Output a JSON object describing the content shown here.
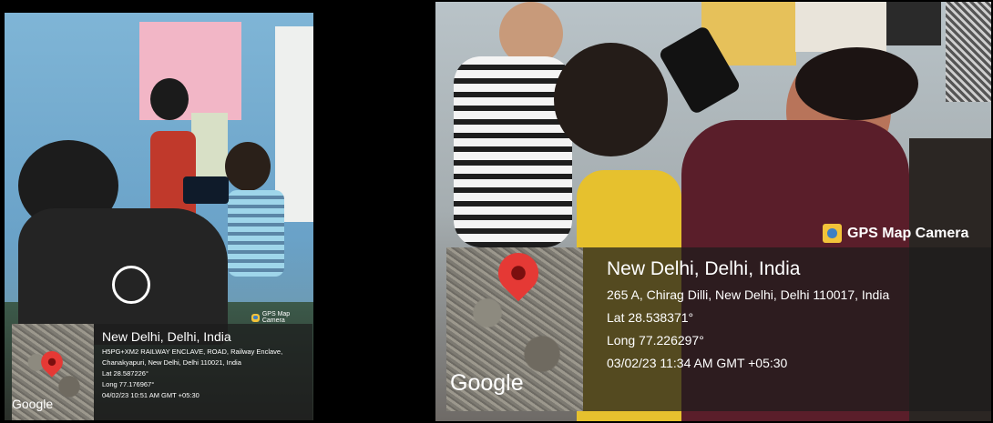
{
  "left_photo": {
    "badge": "GPS Map Camera",
    "title": "New Delhi, Delhi, India",
    "address": "H5PG+XM2 RAILWAY ENCLAVE, ROAD, Railway Enclave, Chanakyapuri, New Delhi, Delhi 110021, India",
    "lat": "Lat 28.587226°",
    "long": "Long 77.176967°",
    "timestamp": "04/02/23 10:51 AM GMT +05:30",
    "map_logo": "Google"
  },
  "right_photo": {
    "badge": "GPS Map Camera",
    "title": "New Delhi, Delhi, India",
    "address": "265 A, Chirag Dilli, New Delhi, Delhi 110017, India",
    "lat": "Lat 28.538371°",
    "long": "Long 77.226297°",
    "timestamp": "03/02/23 11:34 AM GMT +05:30",
    "map_logo": "Google"
  },
  "colors": {
    "background": "#000000",
    "pin": "#e53935",
    "overlay": "#1c1c1c"
  },
  "icons": [
    "location-pin-icon",
    "camera-icon"
  ]
}
